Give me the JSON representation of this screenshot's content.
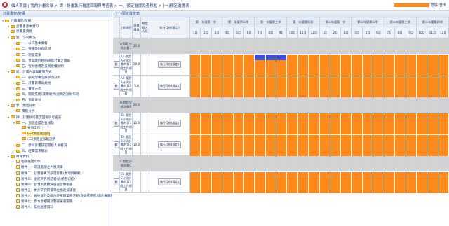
{
  "header": {
    "title": "個人首頁 | 我的計畫名稱 > 課 / 計畫執行進度回報與考查表 > 一、預定進度及查核點 > (一)預定進度表",
    "hello": "您好",
    "logout": "登出"
  },
  "left_panel": {
    "title": "計畫書架/架構",
    "tree": [
      {
        "depth": 0,
        "arrow": "▾",
        "icon": "folder",
        "label": "計畫書架/架構"
      },
      {
        "depth": 1,
        "arrow": "▾",
        "icon": "folder",
        "label": "計畫書基本資料"
      },
      {
        "depth": 1,
        "arrow": "",
        "icon": "folder",
        "label": "計畫書摘要"
      },
      {
        "depth": 1,
        "arrow": "▾",
        "icon": "folder",
        "label": "壹、公司概況"
      },
      {
        "depth": 2,
        "arrow": "›",
        "icon": "folder",
        "label": "一、公司基本資料"
      },
      {
        "depth": 2,
        "arrow": "›",
        "icon": "folder",
        "label": "二、營運及財務狀況"
      },
      {
        "depth": 2,
        "arrow": "›",
        "icon": "folder",
        "label": "三、研發成果"
      },
      {
        "depth": 2,
        "arrow": "›",
        "icon": "folder",
        "label": "四、參與政府相關研發計畫之實績"
      },
      {
        "depth": 2,
        "arrow": "›",
        "icon": "folder",
        "label": "五、智財應用及技術授權說明"
      },
      {
        "depth": 1,
        "arrow": "▾",
        "icon": "folder",
        "label": "貳、計畫內容與實施方式"
      },
      {
        "depth": 2,
        "arrow": "›",
        "icon": "folder",
        "label": "一、研究架構及競爭力分析"
      },
      {
        "depth": 2,
        "arrow": "›",
        "icon": "folder",
        "label": "二、計畫目標與規格"
      },
      {
        "depth": 2,
        "arrow": "›",
        "icon": "folder",
        "label": "三、實施方式"
      },
      {
        "depth": 2,
        "arrow": "›",
        "icon": "folder",
        "label": "四、關鍵技術(或零組件)說明及智財布局"
      },
      {
        "depth": 2,
        "arrow": "›",
        "icon": "folder",
        "label": "五、預期效益"
      },
      {
        "depth": 1,
        "arrow": "▾",
        "icon": "folder",
        "label": "參、預定分析"
      },
      {
        "depth": 2,
        "arrow": "",
        "icon": "folder",
        "label": "風險分析"
      },
      {
        "depth": 1,
        "arrow": "▾",
        "icon": "folder",
        "label": "肆、計畫執行進度回報與考查表"
      },
      {
        "depth": 2,
        "arrow": "▾",
        "icon": "folder",
        "label": "一、預定進度及查核點"
      },
      {
        "depth": 3,
        "arrow": "",
        "icon": "folder",
        "label": "分項工作"
      },
      {
        "depth": 3,
        "arrow": "",
        "icon": "folder",
        "label": "(一)預定進度表",
        "selected": true
      },
      {
        "depth": 3,
        "arrow": "",
        "icon": "folder",
        "label": "(二)預定查核點說明"
      },
      {
        "depth": 2,
        "arrow": "›",
        "icon": "folder",
        "label": "二、參與計畫研究開發人員概況"
      },
      {
        "depth": 2,
        "arrow": "›",
        "icon": "folder",
        "label": "三、經費需求總表"
      },
      {
        "depth": 1,
        "arrow": "▾",
        "icon": "folder",
        "label": "附件資料"
      },
      {
        "depth": 2,
        "arrow": "",
        "icon": "leaf",
        "label": "相關佐證文件"
      },
      {
        "depth": 2,
        "arrow": "",
        "icon": "leaf",
        "label": "附件一：研議邀請之人員清單"
      },
      {
        "depth": 2,
        "arrow": "",
        "icon": "leaf",
        "label": "附件二：計畫書專案研發計畫(本項目規範)"
      },
      {
        "depth": 2,
        "arrow": "",
        "icon": "leaf",
        "label": "附件三：委託研究切結書(含保密切結)"
      },
      {
        "depth": 2,
        "arrow": "",
        "icon": "leaf",
        "label": "附件四：智慧財產權歸屬書暨聲明書"
      },
      {
        "depth": 2,
        "arrow": "",
        "icon": "leaf",
        "label": "附件五：委外研究研發單位指定協議書"
      },
      {
        "depth": 2,
        "arrow": "",
        "icon": "leaf",
        "label": "附件六：轉往國外及國內外舉辦業務活動(含委託研究)國外專屬報告"
      },
      {
        "depth": 2,
        "arrow": "",
        "icon": "leaf",
        "label": "附件七：資本額相關計劃書著書服務"
      },
      {
        "depth": 2,
        "arrow": "",
        "icon": "leaf",
        "label": "附件八：其他佐證資料"
      }
    ]
  },
  "right_panel": {
    "title": "(一)預定進度表",
    "col_headers": {
      "item": "工作項目",
      "weight": "計畫權重",
      "manpower": "預定投入人月",
      "exec_button": "執行月份(設定)"
    },
    "quarters": [
      "第一年度第一季",
      "第一年度第二季",
      "第一年度第三季",
      "第一年度第四季",
      "第二年度第一季",
      "第二年度第二季",
      "第二年度第三季",
      "第二年度第四季"
    ],
    "months": [
      "1月",
      "2月",
      "3月",
      "4月",
      "5月",
      "6月",
      "7月",
      "8月",
      "9月",
      "10月",
      "11月",
      "12月",
      "1月",
      "2月",
      "3月",
      "4月",
      "5月",
      "6月",
      "7月",
      "8月",
      "9月",
      "10月",
      "11月",
      "12月"
    ],
    "rows": [
      {
        "type": "group",
        "item": "A-我是分項計畫1",
        "weight": "25.0",
        "manpower": ""
      },
      {
        "type": "task",
        "item": "A1-我是A分項計畫的第1個工作項目",
        "weight": "20.0",
        "manpower": "",
        "btn": "執行月份(設定)",
        "blue": [
          7,
          8,
          9
        ],
        "edit": "修"
      },
      {
        "type": "task",
        "item": "A2-我是A分項計畫的第2個工作項目",
        "weight": "5.0",
        "manpower": "",
        "btn": "執行月份(設定)",
        "blue": [],
        "edit": "修"
      },
      {
        "type": "group",
        "item": "B-我是分項計畫B",
        "weight": "25.0",
        "manpower": ""
      },
      {
        "type": "task",
        "item": "B1-我是B分項計畫的第1個工作項目",
        "weight": "15.0",
        "manpower": "",
        "btn": "執行月份(設定)",
        "blue": [],
        "edit": "修"
      },
      {
        "type": "task",
        "item": "B2-我是B分項計畫的第2個工作項目",
        "weight": "10.0",
        "manpower": "",
        "btn": "執行月份(設定)",
        "blue": [],
        "edit": "修"
      },
      {
        "type": "group",
        "item": "C-我是分項計畫C",
        "weight": "",
        "manpower": ""
      },
      {
        "type": "task",
        "item": "C1-我是C分項計畫的第1個工作項目",
        "weight": "",
        "manpower": "",
        "btn": "執行月份(設定)",
        "blue": [],
        "edit": "修"
      }
    ]
  },
  "colors": {
    "gantt_fill": "#ff8a1c",
    "gantt_selected": "#3d4fd6",
    "group_row": "#d2d2d2"
  }
}
